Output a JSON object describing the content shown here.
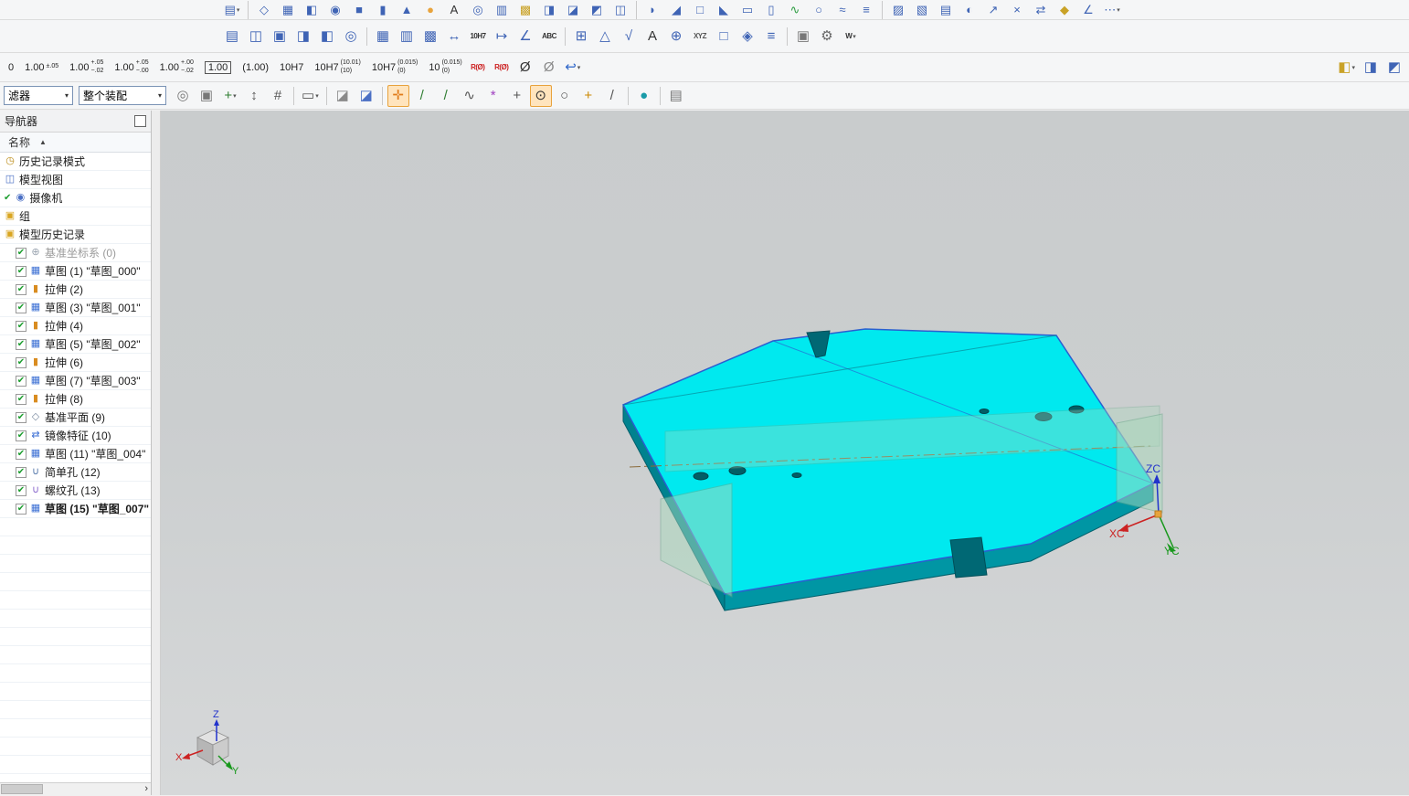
{
  "colors": {
    "part_top": "#00e9ef",
    "part_side": "#0096a4",
    "part_side2": "#00828f",
    "slot": "#006874",
    "sketch_edge": "#2a5fd0",
    "plane_fill": "#a9d8bc",
    "axis_x": "#cc2222",
    "axis_y": "#18981c",
    "axis_z": "#2233cc"
  },
  "toolbar1": {
    "icons": [
      {
        "n": "new-component-icon",
        "g": "▤",
        "dd": true
      },
      {
        "sep": true
      },
      {
        "n": "datum-plane-icon",
        "g": "◇"
      },
      {
        "n": "sketch-icon",
        "g": "▦"
      },
      {
        "n": "extrude-icon",
        "g": "◧"
      },
      {
        "n": "revolve-icon",
        "g": "◉"
      },
      {
        "n": "block-icon",
        "g": "■"
      },
      {
        "n": "cylinder-icon",
        "g": "▮"
      },
      {
        "n": "cone-icon",
        "g": "▲"
      },
      {
        "n": "sphere-icon",
        "g": "●",
        "c": "#e8a33c"
      },
      {
        "n": "text-icon",
        "g": "A",
        "c": "#333333"
      },
      {
        "n": "hole-icon",
        "g": "◎"
      },
      {
        "n": "rib-icon",
        "g": "▥"
      },
      {
        "n": "pattern-feature-icon",
        "g": "▩",
        "c": "#c9a227"
      },
      {
        "n": "mirror-feature-icon",
        "g": "◨"
      },
      {
        "n": "unite-icon",
        "g": "◪"
      },
      {
        "n": "subtract-icon",
        "g": "◩"
      },
      {
        "n": "intersect-icon",
        "g": "◫"
      },
      {
        "sep": true
      },
      {
        "n": "edge-blend-icon",
        "g": "◗"
      },
      {
        "n": "chamfer-icon",
        "g": "◢"
      },
      {
        "n": "shell-icon",
        "g": "□"
      },
      {
        "n": "draft-icon",
        "g": "◣"
      },
      {
        "n": "trim-body-icon",
        "g": "▭"
      },
      {
        "n": "split-body-icon",
        "g": "▯"
      },
      {
        "n": "swept-icon",
        "g": "∿",
        "c": "#2f9e44"
      },
      {
        "n": "tube-icon",
        "g": "○"
      },
      {
        "n": "through-curves-icon",
        "g": "≈"
      },
      {
        "n": "ruled-surface-icon",
        "g": "≡"
      },
      {
        "sep": true
      },
      {
        "n": "offset-surface-icon",
        "g": "▨"
      },
      {
        "n": "thicken-icon",
        "g": "▧"
      },
      {
        "n": "sew-icon",
        "g": "▤"
      },
      {
        "n": "patch-icon",
        "g": "◐"
      },
      {
        "n": "move-face-icon",
        "g": "↗"
      },
      {
        "n": "delete-face-icon",
        "g": "×"
      },
      {
        "n": "replace-face-icon",
        "g": "⇄"
      },
      {
        "n": "synchronous-modeling-icon",
        "g": "◆",
        "c": "#c9a227"
      },
      {
        "n": "measure-icon",
        "g": "∠"
      },
      {
        "n": "more-commands-icon",
        "g": "⋯",
        "dd": true
      }
    ]
  },
  "toolbar2": {
    "icons": [
      {
        "n": "new-sheet-icon",
        "g": "▤"
      },
      {
        "n": "view-wizard-icon",
        "g": "◫"
      },
      {
        "n": "base-view-icon",
        "g": "▣"
      },
      {
        "n": "projected-view-icon",
        "g": "◨"
      },
      {
        "n": "section-view-icon",
        "g": "◧"
      },
      {
        "n": "detail-view-icon",
        "g": "◎"
      },
      {
        "sep": true
      },
      {
        "n": "table-icon",
        "g": "▦"
      },
      {
        "n": "parts-list-icon",
        "g": "▥"
      },
      {
        "n": "grid-icon",
        "g": "▩"
      },
      {
        "n": "rapid-dimension-icon",
        "g": "↔"
      },
      {
        "n": "hole-shaft-tolerance-icon",
        "g": "10H7",
        "txt": true,
        "c": "#333333"
      },
      {
        "n": "ordinate-dimension-icon",
        "g": "↦"
      },
      {
        "n": "angular-dimension-icon",
        "g": "∠"
      },
      {
        "n": "note-icon",
        "g": "ABC",
        "txt": true,
        "c": "#333333"
      },
      {
        "sep": true
      },
      {
        "n": "feature-control-frame-icon",
        "g": "⊞"
      },
      {
        "n": "datum-feature-icon",
        "g": "△"
      },
      {
        "n": "surface-finish-icon",
        "g": "√"
      },
      {
        "n": "text-style-icon",
        "g": "A",
        "c": "#333333"
      },
      {
        "n": "target-point-icon",
        "g": "⊕"
      },
      {
        "n": "coordinate-note-icon",
        "g": "XYZ",
        "txt": true,
        "c": "#555555"
      },
      {
        "n": "blank-symbol-icon",
        "g": "□"
      },
      {
        "n": "custom-symbol-icon",
        "g": "◈"
      },
      {
        "n": "edit-annotation-icon",
        "g": "≡"
      },
      {
        "sep": true
      },
      {
        "n": "image-icon",
        "g": "▣",
        "c": "#777777"
      },
      {
        "n": "settings-gear-icon",
        "g": "⚙",
        "c": "#666666"
      },
      {
        "n": "weld-symbol-icon",
        "g": "W",
        "txt": true,
        "c": "#333333",
        "dd": true
      }
    ]
  },
  "tol_toolbar": {
    "buttons": [
      {
        "n": "tol-partial-button",
        "main": "0"
      },
      {
        "n": "tol-plusminus-button",
        "main": "1.00",
        "sup": "±.05"
      },
      {
        "n": "tol-bilateral-button",
        "main": "1.00",
        "sup": "+.05",
        "sub": "−.02"
      },
      {
        "n": "tol-upper-button",
        "main": "1.00",
        "sup": "+.05",
        "sub": "−.00"
      },
      {
        "n": "tol-lower-button",
        "main": "1.00",
        "sup": "+.00",
        "sub": "−.02"
      },
      {
        "n": "tol-boxed-button",
        "main": "1.00",
        "boxed": true
      },
      {
        "n": "tol-reference-button",
        "main": "(1.00)"
      },
      {
        "n": "tol-fit-button",
        "main": "10H7"
      },
      {
        "n": "tol-fit-values-button",
        "main": "10H7",
        "sup": "(10.01)",
        "sub": "(10)"
      },
      {
        "n": "tol-fit-limits-button",
        "main": "10H7",
        "sup": "(0.015)",
        "sub": "(0)"
      },
      {
        "n": "tol-limits-button",
        "main": "10",
        "sup": "(0.015)",
        "sub": "(0)"
      }
    ],
    "icons": [
      {
        "n": "radius-dimension-icon",
        "g": "R(Ø)",
        "txt": true,
        "c": "#cc2222"
      },
      {
        "n": "radius-to-center-icon",
        "g": "R(Ø)",
        "txt": true,
        "c": "#cc2222"
      },
      {
        "n": "diameter-dimension-icon",
        "g": "Ø",
        "c": "#333333"
      },
      {
        "n": "no-diameter-symbol-icon",
        "g": "Ø",
        "c": "#888888"
      },
      {
        "n": "undo-icon",
        "g": "↩",
        "c": "#2e66c9",
        "dd": true
      }
    ],
    "corner_icons": [
      {
        "n": "work-section-cube-icon",
        "g": "◧",
        "c": "#c9a227",
        "dd": true
      },
      {
        "n": "clip-section-cube-icon",
        "g": "◨"
      },
      {
        "n": "edit-section-cube-icon",
        "g": "◩"
      }
    ]
  },
  "selection_bar": {
    "filter_value": "滤器",
    "scope_value": "整个装配",
    "icons": [
      {
        "n": "find-component-icon",
        "g": "◎",
        "c": "#777777"
      },
      {
        "n": "open-in-window-icon",
        "g": "▣",
        "c": "#777777"
      },
      {
        "n": "add-to-selection-icon",
        "g": "+",
        "c": "#2f7d32",
        "dd": true
      },
      {
        "n": "move-object-icon",
        "g": "↕",
        "c": "#555555"
      },
      {
        "n": "show-constraints-icon",
        "g": "#",
        "c": "#555555"
      },
      {
        "sep": true
      },
      {
        "n": "rectangle-select-icon",
        "g": "▭",
        "c": "#555555",
        "dd": true
      },
      {
        "sep": true
      },
      {
        "n": "general-object-filter-icon",
        "g": "◪",
        "c": "#8a8a8a"
      },
      {
        "n": "solid-body-filter-icon",
        "g": "◪",
        "c": "#4a6fc4"
      },
      {
        "sep": true
      },
      {
        "n": "snap-point-enable-icon",
        "g": "✛",
        "c": "#e07b1a",
        "pressed": true
      },
      {
        "n": "snap-endpoint-icon",
        "g": "/",
        "c": "#2f7d32"
      },
      {
        "n": "snap-midpoint-icon",
        "g": "/",
        "c": "#2f7d32"
      },
      {
        "n": "snap-control-point-icon",
        "g": "∿",
        "c": "#555555"
      },
      {
        "n": "snap-pole-icon",
        "g": "*",
        "c": "#a040c0"
      },
      {
        "n": "snap-intersection-icon",
        "g": "+",
        "c": "#555555"
      },
      {
        "n": "snap-arc-center-icon",
        "g": "⊙",
        "c": "#333333",
        "pressed": true
      },
      {
        "n": "snap-quadrant-icon",
        "g": "○",
        "c": "#555555"
      },
      {
        "n": "snap-existing-point-icon",
        "g": "+",
        "c": "#cc8800"
      },
      {
        "n": "snap-tangent-icon",
        "g": "/",
        "c": "#555555"
      },
      {
        "sep": true
      },
      {
        "n": "snap-sphere-icon",
        "g": "●",
        "c": "#1a9ba8"
      },
      {
        "sep": true
      },
      {
        "n": "clipboard-icon",
        "g": "▤",
        "c": "#777777"
      }
    ]
  },
  "navigator": {
    "title": "导航器",
    "col_header": "名称",
    "rows": [
      {
        "n": "tree-item-history-mode",
        "icon": "history-mode-icon",
        "g": "◷",
        "c": "#b8860b",
        "label": "历史记录模式"
      },
      {
        "n": "tree-item-model-views",
        "icon": "model-views-icon",
        "g": "◫",
        "c": "#4a6fc4",
        "label": "模型视图"
      },
      {
        "n": "tree-item-cameras",
        "icon": "camera-icon",
        "g": "◉",
        "c": "#4a6fc4",
        "pre": "✔",
        "label": "摄像机"
      },
      {
        "n": "tree-item-groups",
        "icon": "folder-icon",
        "g": "▣",
        "c": "#d9a520",
        "label": "组"
      },
      {
        "n": "tree-item-model-history",
        "icon": "folder-icon",
        "g": "▣",
        "c": "#d9a520",
        "label": "模型历史记录"
      },
      {
        "n": "tree-item-datum-csys",
        "check": true,
        "icon": "datum-csys-icon",
        "g": "⊕",
        "c": "#9aa4b0",
        "label": "基准坐标系 (0)",
        "dim": true
      },
      {
        "n": "tree-item-sketch-1",
        "check": true,
        "icon": "sketch-icon",
        "g": "▦",
        "c": "#3b6fd4",
        "label": "草图 (1) \"草图_000\""
      },
      {
        "n": "tree-item-extrude-2",
        "check": true,
        "icon": "extrude-icon",
        "g": "▮",
        "c": "#d98c20",
        "label": "拉伸 (2)"
      },
      {
        "n": "tree-item-sketch-3",
        "check": true,
        "icon": "sketch-icon",
        "g": "▦",
        "c": "#3b6fd4",
        "label": "草图 (3) \"草图_001\""
      },
      {
        "n": "tree-item-extrude-4",
        "check": true,
        "icon": "extrude-icon",
        "g": "▮",
        "c": "#d98c20",
        "label": "拉伸 (4)"
      },
      {
        "n": "tree-item-sketch-5",
        "check": true,
        "icon": "sketch-icon",
        "g": "▦",
        "c": "#3b6fd4",
        "label": "草图 (5) \"草图_002\""
      },
      {
        "n": "tree-item-extrude-6",
        "check": true,
        "icon": "extrude-icon",
        "g": "▮",
        "c": "#d98c20",
        "label": "拉伸 (6)"
      },
      {
        "n": "tree-item-sketch-7",
        "check": true,
        "icon": "sketch-icon",
        "g": "▦",
        "c": "#3b6fd4",
        "label": "草图 (7) \"草图_003\""
      },
      {
        "n": "tree-item-extrude-8",
        "check": true,
        "icon": "extrude-icon",
        "g": "▮",
        "c": "#d98c20",
        "label": "拉伸 (8)"
      },
      {
        "n": "tree-item-datum-plane-9",
        "check": true,
        "icon": "datum-plane-icon",
        "g": "◇",
        "c": "#7a8aa0",
        "label": "基准平面 (9)"
      },
      {
        "n": "tree-item-mirror-feature-10",
        "check": true,
        "icon": "mirror-feature-icon",
        "g": "⇄",
        "c": "#3b6fd4",
        "label": "镜像特征 (10)"
      },
      {
        "n": "tree-item-sketch-11",
        "check": true,
        "icon": "sketch-icon",
        "g": "▦",
        "c": "#3b6fd4",
        "label": "草图 (11) \"草图_004\""
      },
      {
        "n": "tree-item-simple-hole-12",
        "check": true,
        "icon": "simple-hole-icon",
        "g": "∪",
        "c": "#5577aa",
        "label": "简单孔 (12)"
      },
      {
        "n": "tree-item-threaded-hole-13",
        "check": true,
        "icon": "threaded-hole-icon",
        "g": "∪",
        "c": "#8866cc",
        "label": "螺纹孔 (13)"
      },
      {
        "n": "tree-item-sketch-15",
        "check": true,
        "icon": "sketch-icon",
        "g": "▦",
        "c": "#3b6fd4",
        "label": "草图 (15) \"草图_007\"",
        "bold": true
      }
    ],
    "scroll_arrow": "›"
  },
  "viewport": {
    "wcs_labels": {
      "x": "XC",
      "y": "YC",
      "z": "ZC"
    },
    "triad_labels": {
      "x": "X",
      "y": "Y",
      "z": "Z"
    }
  }
}
